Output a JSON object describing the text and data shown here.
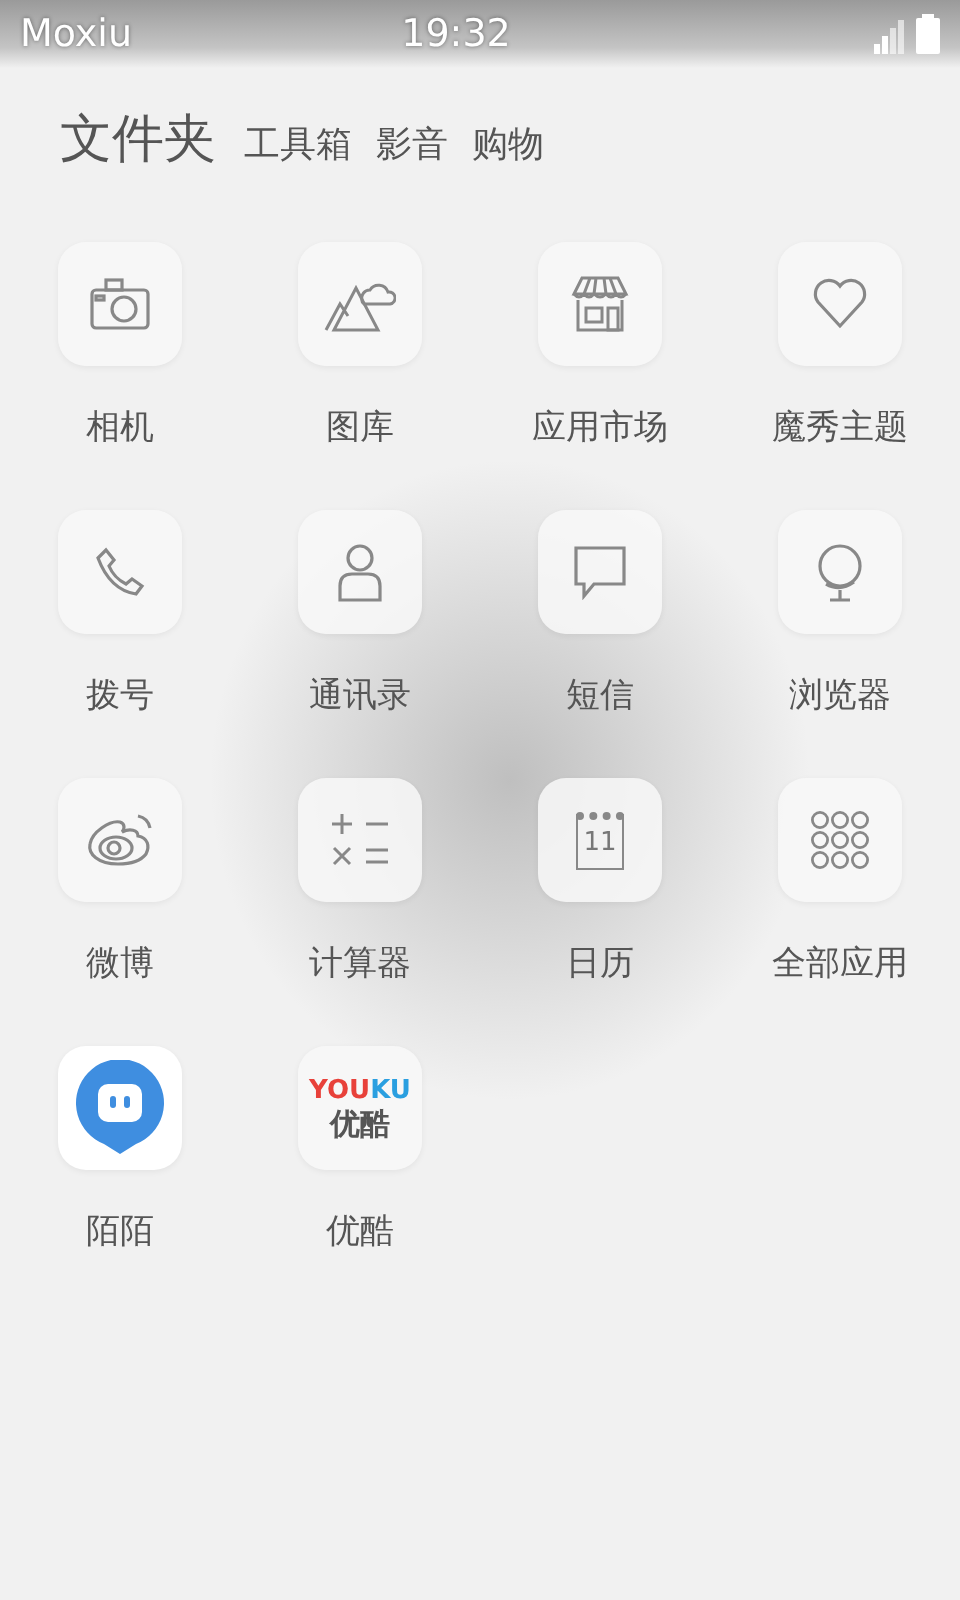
{
  "status_bar": {
    "carrier": "Moxiu",
    "time": "19:32"
  },
  "tabs": [
    {
      "label": "文件夹",
      "selected": true
    },
    {
      "label": "工具箱",
      "selected": false
    },
    {
      "label": "影音",
      "selected": false
    },
    {
      "label": "购物",
      "selected": false
    }
  ],
  "apps": [
    {
      "kind": "camera",
      "label": "相机"
    },
    {
      "kind": "gallery",
      "label": "图库"
    },
    {
      "kind": "store",
      "label": "应用市场"
    },
    {
      "kind": "heart",
      "label": "魔秀主题"
    },
    {
      "kind": "phone",
      "label": "拨号"
    },
    {
      "kind": "contact",
      "label": "通讯录"
    },
    {
      "kind": "message",
      "label": "短信"
    },
    {
      "kind": "globe",
      "label": "浏览器"
    },
    {
      "kind": "eye",
      "label": "微博"
    },
    {
      "kind": "calculator",
      "label": "计算器"
    },
    {
      "kind": "calendar",
      "label": "日历",
      "icon_text": "11"
    },
    {
      "kind": "grid",
      "label": "全部应用"
    },
    {
      "kind": "chat",
      "label": "陌陌"
    },
    {
      "kind": "logo",
      "label": "优酷",
      "logo": [
        {
          "text": "YOU",
          "color": "#e8413a"
        },
        {
          "text": "KU",
          "color": "#2a9fe0"
        }
      ],
      "logo_sub": "优酷"
    }
  ]
}
